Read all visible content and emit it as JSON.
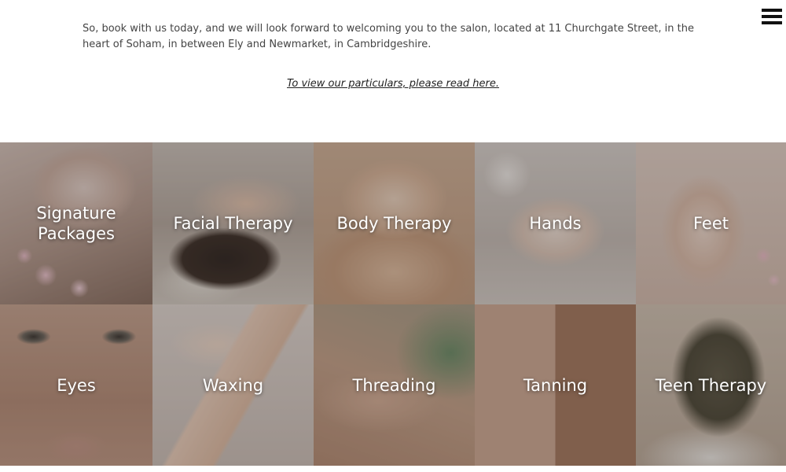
{
  "header": {
    "menu_icon": "hamburger-menu-icon"
  },
  "intro": {
    "text": "So, book with us today, and we will look forward to welcoming you to the salon, located at 11 Churchgate Street, in the heart of Soham, in between Ely and Newmarket, in Cambridgeshire.",
    "link_text": "To view our particulars, please read here."
  },
  "services": [
    {
      "label": "Signature Packages"
    },
    {
      "label": "Facial Therapy"
    },
    {
      "label": "Body Therapy"
    },
    {
      "label": "Hands"
    },
    {
      "label": "Feet"
    },
    {
      "label": "Eyes"
    },
    {
      "label": "Waxing"
    },
    {
      "label": "Threading"
    },
    {
      "label": "Tanning"
    },
    {
      "label": "Teen Therapy"
    }
  ],
  "colors": {
    "text": "#444444",
    "overlay_text": "#ffffff",
    "menu_icon": "#111111"
  }
}
